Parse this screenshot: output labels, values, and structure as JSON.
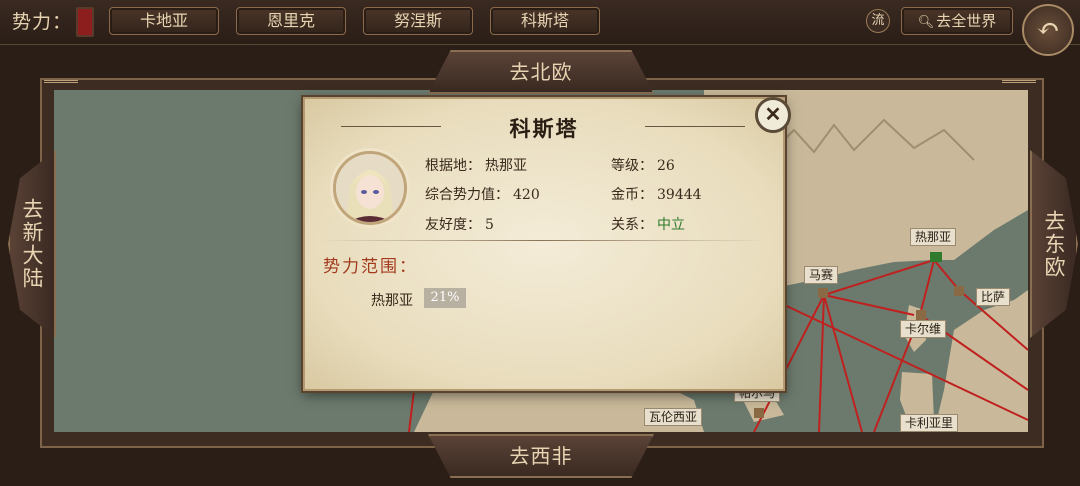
{
  "top_bar": {
    "faction_label": "势力：",
    "faction_tabs": [
      "卡地亚",
      "恩里克",
      "努涅斯",
      "科斯塔"
    ],
    "stream_button": "流",
    "world_button": "去全世界"
  },
  "nav": {
    "north": "去北欧",
    "south": "去西非",
    "west": "去新大陆",
    "east": "去东欧"
  },
  "map": {
    "cities": [
      "热那亚",
      "马赛",
      "比萨",
      "卡尔维",
      "帕尔马",
      "瓦伦西亚",
      "卡利亚里"
    ]
  },
  "dialog": {
    "title": "科斯塔",
    "base_label": "根据地：",
    "base_value": "热那亚",
    "level_label": "等级：",
    "level_value": "26",
    "power_label": "综合势力值：",
    "power_value": "420",
    "gold_label": "金币：",
    "gold_value": "39444",
    "friend_label": "友好度：",
    "friend_value": "5",
    "relation_label": "关系：",
    "relation_value": "中立",
    "sphere_title": "势力范围：",
    "sphere": [
      {
        "name": "热那亚",
        "percent": "21%"
      }
    ]
  },
  "colors": {
    "accent_red": "#a23a1e",
    "neutral_green": "#2f7a2c",
    "route_red": "#c0201e"
  }
}
